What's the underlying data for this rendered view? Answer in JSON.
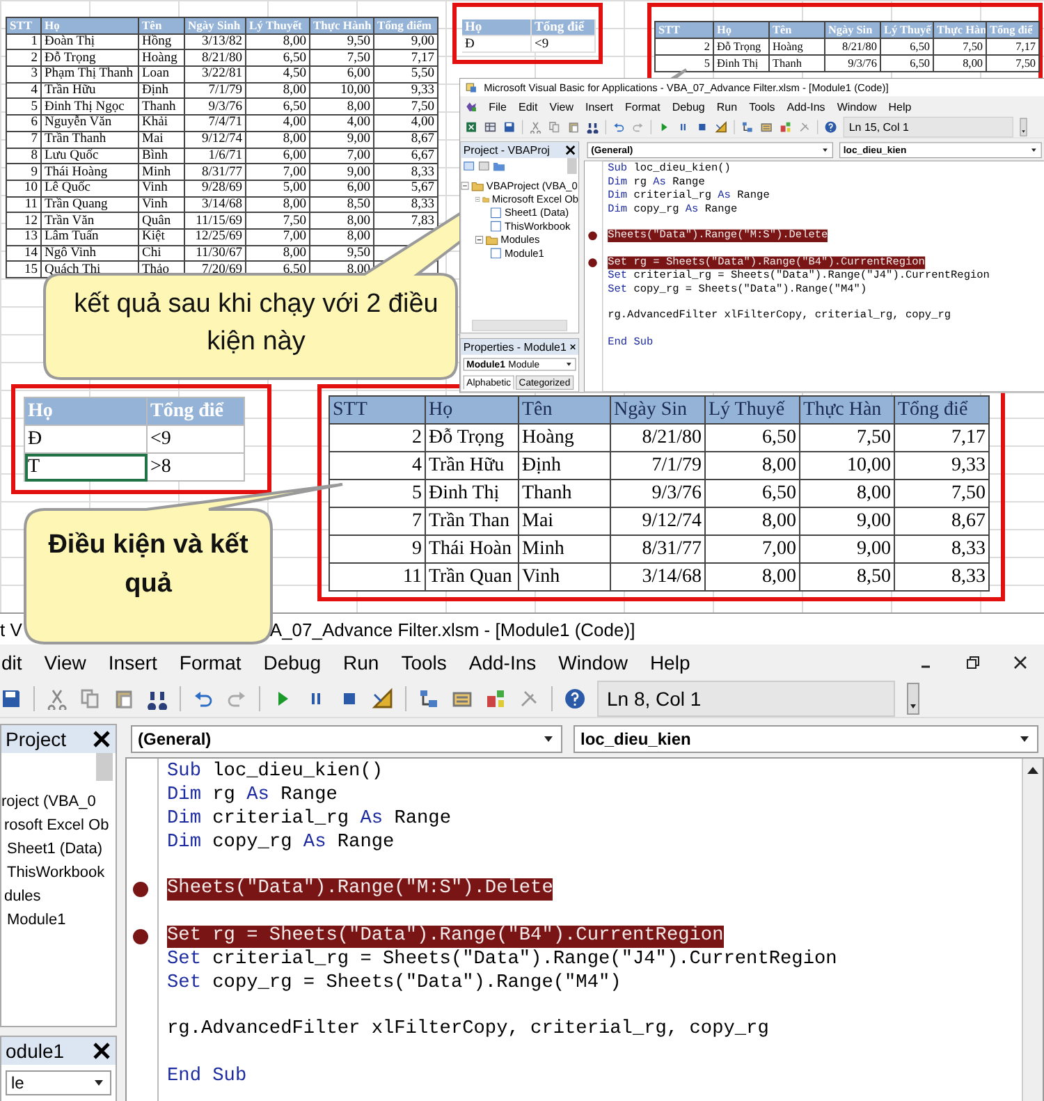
{
  "sheet_table": {
    "columns": [
      "STT",
      "Họ",
      "Tên",
      "Ngày Sinh",
      "Lý Thuyết",
      "Thực Hành",
      "Tổng điểm"
    ],
    "rows": [
      [
        "1",
        "Đoàn Thị",
        "Hồng",
        "3/13/82",
        "8,00",
        "9,50",
        "9,00"
      ],
      [
        "2",
        "Đỗ Trọng",
        "Hoàng",
        "8/21/80",
        "6,50",
        "7,50",
        "7,17"
      ],
      [
        "3",
        "Phạm Thị Thanh",
        "Loan",
        "3/22/81",
        "4,50",
        "6,00",
        "5,50"
      ],
      [
        "4",
        "Trần Hữu",
        "Định",
        "7/1/79",
        "8,00",
        "10,00",
        "9,33"
      ],
      [
        "5",
        "Đinh Thị Ngọc",
        "Thanh",
        "9/3/76",
        "6,50",
        "8,00",
        "7,50"
      ],
      [
        "6",
        "Nguyễn Văn",
        "Khải",
        "7/4/71",
        "4,00",
        "4,00",
        "4,00"
      ],
      [
        "7",
        "Trần Thanh",
        "Mai",
        "9/12/74",
        "8,00",
        "9,00",
        "8,67"
      ],
      [
        "8",
        "Lưu Quốc",
        "Bình",
        "1/6/71",
        "6,00",
        "7,00",
        "6,67"
      ],
      [
        "9",
        "Thái Hoàng",
        "Minh",
        "8/31/77",
        "7,00",
        "9,00",
        "8,33"
      ],
      [
        "10",
        "Lê Quốc",
        "Vinh",
        "9/28/69",
        "5,00",
        "6,00",
        "5,67"
      ],
      [
        "11",
        "Trần Quang",
        "Vinh",
        "3/14/68",
        "8,00",
        "8,50",
        "8,33"
      ],
      [
        "12",
        "Trần Văn",
        "Quân",
        "11/15/69",
        "7,50",
        "8,00",
        "7,83"
      ],
      [
        "13",
        "Lâm Tuấn",
        "Kiệt",
        "12/25/69",
        "7,00",
        "8,00",
        null
      ],
      [
        "14",
        "Ngô Vinh",
        "Chi",
        "11/30/67",
        "8,00",
        "9,50",
        null
      ],
      [
        "15",
        "Quách Thị",
        "Thảo",
        "7/20/69",
        "6,50",
        "8,00",
        null
      ]
    ]
  },
  "top_criteria": {
    "columns": [
      "Họ",
      "Tổng điể"
    ],
    "rows": [
      [
        "Đ",
        "<9"
      ]
    ]
  },
  "top_result": {
    "columns": [
      "STT",
      "Họ",
      "Tên",
      "Ngày Sin",
      "Lý Thuyế",
      "Thực Hàn",
      "Tổng điể"
    ],
    "rows": [
      [
        "2",
        "Đỗ Trọng",
        "Hoàng",
        "8/21/80",
        "6,50",
        "7,50",
        "7,17"
      ],
      [
        "5",
        "Đinh Thị",
        "Thanh",
        "9/3/76",
        "6,50",
        "8,00",
        "7,50"
      ]
    ]
  },
  "vba_windows": [
    {
      "title_parts": [
        "Microsoft Visual Basic for Applications - VBA_07_Advance Filter.xlsm - [Module1 (Code)]"
      ],
      "menu": [
        "File",
        "Edit",
        "View",
        "Insert",
        "Format",
        "Debug",
        "Run",
        "Tools",
        "Add-Ins",
        "Window",
        "Help"
      ],
      "position": "Ln 15, Col 1",
      "project": {
        "title": "Project - VBAProj",
        "tree": [
          {
            "label": "VBAProject (VBA_0",
            "children": [
              {
                "label": "Microsoft Excel Ob",
                "children": [
                  {
                    "label": "Sheet1 (Data)"
                  },
                  {
                    "label": "ThisWorkbook"
                  }
                ]
              },
              {
                "label": "Modules",
                "children": [
                  {
                    "label": "Module1"
                  }
                ]
              }
            ]
          }
        ]
      },
      "properties": {
        "title": "Properties - Module1",
        "object": {
          "name": "Module1",
          "type": "Module"
        },
        "tabs": [
          {
            "label": "Alphabetic",
            "selected": true
          },
          {
            "label": "Categorized",
            "selected": false
          }
        ]
      },
      "code": {
        "object": "(General)",
        "procedure": "loc_dieu_kien",
        "lines": [
          {
            "kind": "code",
            "breakpoint": false,
            "tokens": [
              {
                "text": "Sub",
                "kind": "keyword"
              },
              {
                "text": " loc_dieu_kien()",
                "kind": "plain"
              }
            ]
          },
          {
            "kind": "code",
            "breakpoint": false,
            "tokens": [
              {
                "text": "Dim",
                "kind": "keyword"
              },
              {
                "text": " rg ",
                "kind": "plain"
              },
              {
                "text": "As",
                "kind": "keyword"
              },
              {
                "text": " Range",
                "kind": "plain"
              }
            ]
          },
          {
            "kind": "code",
            "breakpoint": false,
            "tokens": [
              {
                "text": "Dim",
                "kind": "keyword"
              },
              {
                "text": " criterial_rg ",
                "kind": "plain"
              },
              {
                "text": "As",
                "kind": "keyword"
              },
              {
                "text": " Range",
                "kind": "plain"
              }
            ]
          },
          {
            "kind": "code",
            "breakpoint": false,
            "tokens": [
              {
                "text": "Dim",
                "kind": "keyword"
              },
              {
                "text": " copy_rg ",
                "kind": "plain"
              },
              {
                "text": "As",
                "kind": "keyword"
              },
              {
                "text": " Range",
                "kind": "plain"
              }
            ]
          },
          {
            "kind": "blank"
          },
          {
            "kind": "code",
            "breakpoint": true,
            "tokens": [
              {
                "text": "Sheets(\"Data\").Range(\"M:S\").Delete",
                "kind": "plain"
              }
            ]
          },
          {
            "kind": "blank"
          },
          {
            "kind": "code",
            "breakpoint": true,
            "tokens": [
              {
                "text": "Set",
                "kind": "keyword"
              },
              {
                "text": " rg = Sheets(\"Data\").Range(\"B4\").CurrentRegion",
                "kind": "plain"
              }
            ]
          },
          {
            "kind": "code",
            "breakpoint": false,
            "tokens": [
              {
                "text": "Set",
                "kind": "keyword"
              },
              {
                "text": " criterial_rg = Sheets(\"Data\").Range(\"J4\").CurrentRegion",
                "kind": "plain"
              }
            ]
          },
          {
            "kind": "code",
            "breakpoint": false,
            "tokens": [
              {
                "text": "Set",
                "kind": "keyword"
              },
              {
                "text": " copy_rg = Sheets(\"Data\").Range(\"M4\")",
                "kind": "plain"
              }
            ]
          },
          {
            "kind": "blank"
          },
          {
            "kind": "code",
            "breakpoint": false,
            "tokens": [
              {
                "text": "rg.AdvancedFilter xlFilterCopy, criterial_rg, copy_rg",
                "kind": "plain"
              }
            ]
          },
          {
            "kind": "blank"
          },
          {
            "kind": "code",
            "breakpoint": false,
            "tokens": [
              {
                "text": "End",
                "kind": "keyword"
              },
              {
                "text": " Sub",
                "kind": "keyword"
              }
            ]
          }
        ]
      }
    },
    {
      "title_parts": [
        "t V",
        "A_07_Advance Filter.xlsm - [Module1 (Code)]"
      ],
      "menu": [
        "dit",
        "View",
        "Insert",
        "Format",
        "Debug",
        "Run",
        "Tools",
        "Add-Ins",
        "Window",
        "Help"
      ],
      "position": "Ln 8, Col 1",
      "project": {
        "title": "Project",
        "tree": [
          {
            "label": "roject (VBA_0",
            "children": [
              {
                "label": "rosoft Excel Ob",
                "children": [
                  {
                    "label": "Sheet1 (Data)"
                  },
                  {
                    "label": "ThisWorkbook"
                  }
                ]
              },
              {
                "label": "dules",
                "children": [
                  {
                    "label": "Module1"
                  }
                ]
              }
            ]
          }
        ]
      },
      "properties": {
        "title": "odule1",
        "object": {
          "type": "le"
        }
      },
      "code": {
        "object": "(General)",
        "procedure": "loc_dieu_kien",
        "lines": [
          {
            "kind": "code",
            "breakpoint": false,
            "tokens": [
              {
                "text": "Sub",
                "kind": "keyword"
              },
              {
                "text": " loc_dieu_kien()",
                "kind": "plain"
              }
            ]
          },
          {
            "kind": "code",
            "breakpoint": false,
            "tokens": [
              {
                "text": "Dim",
                "kind": "keyword"
              },
              {
                "text": " rg ",
                "kind": "plain"
              },
              {
                "text": "As",
                "kind": "keyword"
              },
              {
                "text": " Range",
                "kind": "plain"
              }
            ]
          },
          {
            "kind": "code",
            "breakpoint": false,
            "tokens": [
              {
                "text": "Dim",
                "kind": "keyword"
              },
              {
                "text": " criterial_rg ",
                "kind": "plain"
              },
              {
                "text": "As",
                "kind": "keyword"
              },
              {
                "text": " Range",
                "kind": "plain"
              }
            ]
          },
          {
            "kind": "code",
            "breakpoint": false,
            "tokens": [
              {
                "text": "Dim",
                "kind": "keyword"
              },
              {
                "text": " copy_rg ",
                "kind": "plain"
              },
              {
                "text": "As",
                "kind": "keyword"
              },
              {
                "text": " Range",
                "kind": "plain"
              }
            ]
          },
          {
            "kind": "blank"
          },
          {
            "kind": "code",
            "breakpoint": true,
            "tokens": [
              {
                "text": "Sheets(\"Data\").Range(\"M:S\").Delete",
                "kind": "plain"
              }
            ]
          },
          {
            "kind": "blank"
          },
          {
            "kind": "code",
            "breakpoint": true,
            "tokens": [
              {
                "text": "Set",
                "kind": "keyword"
              },
              {
                "text": " rg = Sheets(\"Data\").Range(\"B4\").CurrentRegion",
                "kind": "plain"
              }
            ]
          },
          {
            "kind": "code",
            "breakpoint": false,
            "tokens": [
              {
                "text": "Set",
                "kind": "keyword"
              },
              {
                "text": " criterial_rg = Sheets(\"Data\").Range(\"J4\").CurrentRegion",
                "kind": "plain"
              }
            ]
          },
          {
            "kind": "code",
            "breakpoint": false,
            "tokens": [
              {
                "text": "Set",
                "kind": "keyword"
              },
              {
                "text": " copy_rg = Sheets(\"Data\").Range(\"M4\")",
                "kind": "plain"
              }
            ]
          },
          {
            "kind": "blank"
          },
          {
            "kind": "code",
            "breakpoint": false,
            "tokens": [
              {
                "text": "rg.AdvancedFilter xlFilterCopy, criterial_rg, copy_rg",
                "kind": "plain"
              }
            ]
          },
          {
            "kind": "blank"
          },
          {
            "kind": "code",
            "breakpoint": false,
            "tokens": [
              {
                "text": "End",
                "kind": "keyword"
              },
              {
                "text": " Sub",
                "kind": "keyword"
              }
            ]
          }
        ]
      }
    }
  ],
  "callouts": [
    {
      "text": "kết quả sau khi chạy với 2 điều kiện này"
    },
    {
      "text": "Điều kiện và kết quả"
    }
  ],
  "criteria_table": {
    "columns": [
      "Họ",
      "Tổng điể"
    ],
    "rows": [
      [
        {
          "text": "Đ",
          "selected": false
        },
        {
          "text": "<9",
          "selected": false
        }
      ],
      [
        {
          "text": "T",
          "selected": true
        },
        {
          "text": ">8",
          "selected": false
        }
      ]
    ]
  },
  "result_table": {
    "columns": [
      "STT",
      "Họ",
      "Tên",
      "Ngày Sin",
      "Lý Thuyế",
      "Thực Hàn",
      "Tổng điể"
    ],
    "rows": [
      [
        "2",
        "Đỗ Trọng",
        "Hoàng",
        "8/21/80",
        "6,50",
        "7,50",
        "7,17"
      ],
      [
        "4",
        "Trần Hữu",
        "Định",
        "7/1/79",
        "8,00",
        "10,00",
        "9,33"
      ],
      [
        "5",
        "Đinh Thị",
        "Thanh",
        "9/3/76",
        "6,50",
        "8,00",
        "7,50"
      ],
      [
        "7",
        "Trần Than",
        "Mai",
        "9/12/74",
        "8,00",
        "9,00",
        "8,67"
      ],
      [
        "9",
        "Thái Hoàn",
        "Minh",
        "8/31/77",
        "7,00",
        "9,00",
        "8,33"
      ],
      [
        "11",
        "Trần Quan",
        "Vinh",
        "3/14/68",
        "8,00",
        "8,50",
        "8,33"
      ]
    ]
  }
}
